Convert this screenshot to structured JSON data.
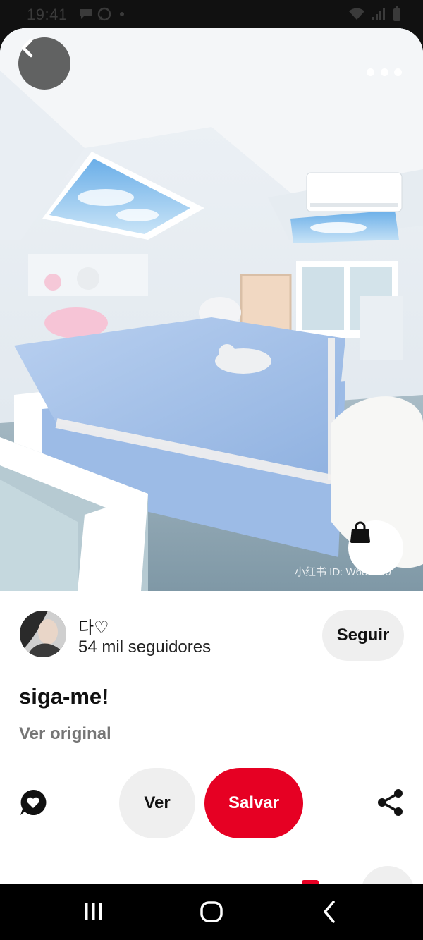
{
  "status_bar": {
    "time": "19:41",
    "left_icons": [
      "chat-bubble-icon",
      "whatsapp-icon"
    ],
    "right_icons": [
      "wifi-icon",
      "signal-icon",
      "battery-icon"
    ]
  },
  "pin": {
    "image_icons": {
      "back": "chevron-left-icon",
      "more": "more-dots-icon",
      "shop": "shopping-bag-icon"
    },
    "watermark": "小红书 ID: W680000",
    "title": "siga-me!",
    "see_original": "Ver original"
  },
  "author": {
    "name": "다♡",
    "followers": "54 mil seguidores",
    "follow_label": "Seguir"
  },
  "actions": {
    "comment_icon": "comment-heart-icon",
    "view_label": "Ver",
    "save_label": "Salvar",
    "share_icon": "share-icon",
    "save_color": "#e60023"
  },
  "nav": {
    "recents": "recents-icon",
    "home": "home-icon",
    "back": "back-icon"
  }
}
